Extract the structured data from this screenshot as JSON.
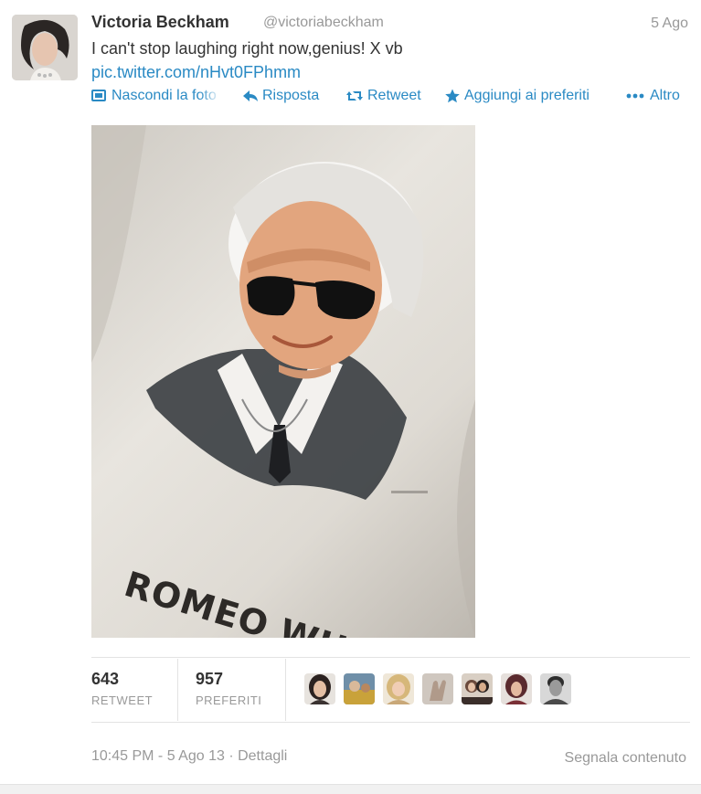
{
  "author": {
    "name": "Victoria Beckham",
    "handle": "@victoriabeckham",
    "date": "5 Ago"
  },
  "tweet": {
    "text": "I can't stop laughing right now,genius! X vb",
    "link": "pic.twitter.com/nHvt0FPhmm"
  },
  "actions": {
    "hide_photo": "Nascondi la foto",
    "reply": "Risposta",
    "retweet": "Retweet",
    "favorite": "Aggiungi ai preferiti",
    "more": "Altro"
  },
  "photo": {
    "shirt_text": "ROMEO WHO?"
  },
  "stats": {
    "retweets": {
      "count": "643",
      "label": "RETWEET"
    },
    "favorites": {
      "count": "957",
      "label": "PREFERITI"
    }
  },
  "favoriters": [
    {
      "icon": "avatar-woman-dark-hair",
      "color": "#3a3230"
    },
    {
      "icon": "avatar-scene-yellow",
      "color": "#c9a23a"
    },
    {
      "icon": "avatar-blonde",
      "color": "#d6b77a"
    },
    {
      "icon": "avatar-hand",
      "color": "#b09a8a"
    },
    {
      "icon": "avatar-couple",
      "color": "#6b4a3c"
    },
    {
      "icon": "avatar-woman-red",
      "color": "#5a2a2e"
    },
    {
      "icon": "avatar-man-bw",
      "color": "#4a4a4a"
    }
  ],
  "footer": {
    "timestamp": "10:45 PM - 5 Ago 13 · Dettagli",
    "report": "Segnala contenuto"
  },
  "colors": {
    "link": "#2a8ac4",
    "muted": "#999999",
    "text": "#333333"
  }
}
